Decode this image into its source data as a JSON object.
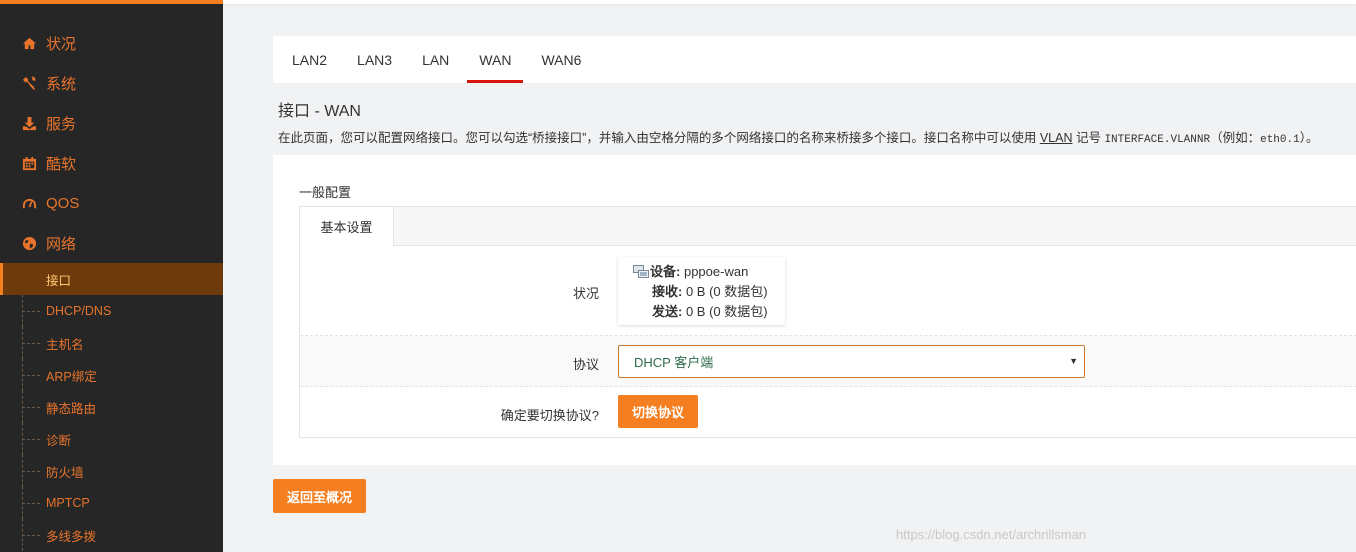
{
  "sidebar": {
    "menu": [
      {
        "label": "状况",
        "icon": "home-icon"
      },
      {
        "label": "系统",
        "icon": "tools-icon"
      },
      {
        "label": "服务",
        "icon": "download-icon"
      },
      {
        "label": "酷软",
        "icon": "calendar-icon"
      },
      {
        "label": "QOS",
        "icon": "gauge-icon"
      },
      {
        "label": "网络",
        "icon": "globe-icon"
      }
    ],
    "submenu": [
      {
        "label": "接口",
        "active": true
      },
      {
        "label": "DHCP/DNS"
      },
      {
        "label": "主机名"
      },
      {
        "label": "ARP绑定"
      },
      {
        "label": "静态路由"
      },
      {
        "label": "诊断"
      },
      {
        "label": "防火墙"
      },
      {
        "label": "MPTCP"
      },
      {
        "label": "多线多拨"
      }
    ]
  },
  "tabs": [
    "LAN2",
    "LAN3",
    "LAN",
    "WAN",
    "WAN6"
  ],
  "active_tab": "WAN",
  "page": {
    "title": "接口 - WAN",
    "desc_part1": "在此页面，您可以配置网络接口。您可以勾选“桥接接口”，并输入由空格分隔的多个网络接口的名称来桥接多个接口。接口名称中可以使用",
    "desc_link": "VLAN",
    "desc_part2": "记号",
    "desc_code": "INTERFACE.VLANNR",
    "desc_part3": "（例如：",
    "desc_example": "eth0.1",
    "desc_part4": "）。"
  },
  "section": {
    "legend": "一般配置",
    "tab": "基本设置"
  },
  "status": {
    "label": "状况",
    "device_key": "设备:",
    "device_val": "pppoe-wan",
    "rx_key": "接收:",
    "rx_val": "0 B (0 数据包)",
    "tx_key": "发送:",
    "tx_val": "0 B (0 数据包)"
  },
  "protocol": {
    "label": "协议",
    "value": "DHCP 客户端"
  },
  "switch": {
    "label": "确定要切换协议?",
    "button": "切换协议"
  },
  "back_button": "返回至概况",
  "watermark": "https://blog.csdn.net/archrillsman",
  "colors": {
    "accent": "#f57f20",
    "sidebar_bg": "#262626",
    "tab_active": "#d9160e"
  }
}
